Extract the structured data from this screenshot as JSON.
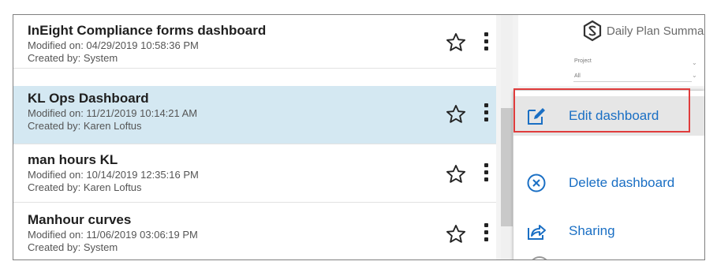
{
  "dashboards": [
    {
      "title": "InEight Compliance forms dashboard",
      "modified": "Modified on: 04/29/2019 10:58:36 PM",
      "created": "Created by: System"
    },
    {
      "title": "KL Ops Dashboard",
      "modified": "Modified on: 11/21/2019 10:14:21 AM",
      "created": "Created by: Karen Loftus"
    },
    {
      "title": "man hours KL",
      "modified": "Modified on: 10/14/2019 12:35:16 PM",
      "created": "Created by: Karen Loftus"
    },
    {
      "title": "Manhour curves",
      "modified": "Modified on: 11/06/2019 03:06:19 PM",
      "created": "Created by: System"
    }
  ],
  "selected_index": 1,
  "preview": {
    "title": "Daily Plan Summary -",
    "project_label": "Project",
    "project_value": "All"
  },
  "context_menu": {
    "items": [
      {
        "label": "Edit dashboard",
        "icon": "edit-icon"
      },
      {
        "label": "Delete dashboard",
        "icon": "delete-circle-x-icon"
      },
      {
        "label": "Sharing",
        "icon": "share-icon"
      }
    ]
  },
  "colors": {
    "selected_row": "#d4e8f2",
    "menu_text": "#1a6fc4",
    "highlight_border": "#e03c3c"
  }
}
